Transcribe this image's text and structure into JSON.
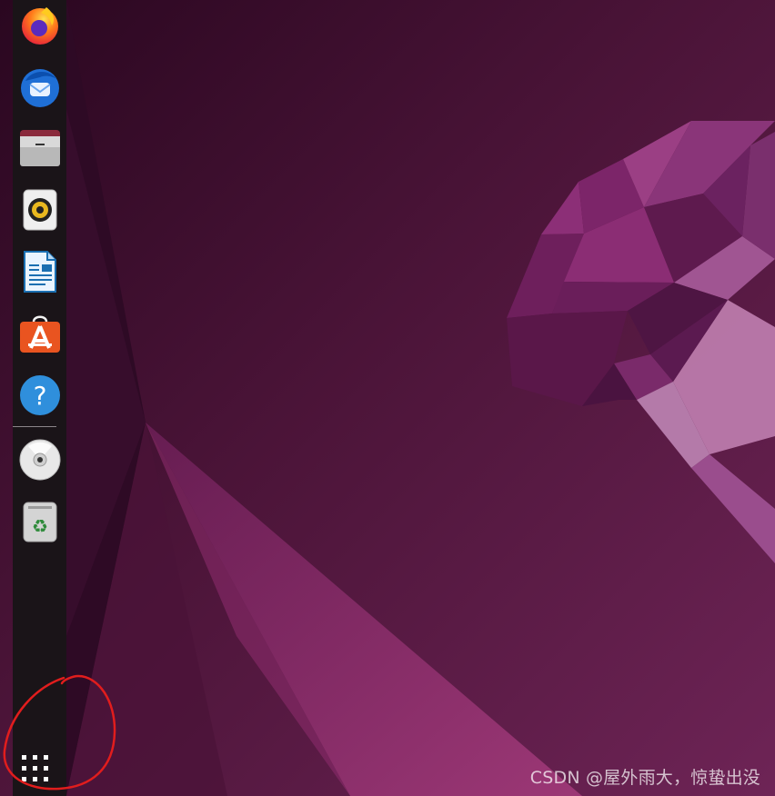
{
  "dock": {
    "apps": [
      {
        "name": "Firefox",
        "icon": "firefox-icon"
      },
      {
        "name": "Thunderbird",
        "icon": "thunderbird-icon"
      },
      {
        "name": "Files",
        "icon": "files-icon"
      },
      {
        "name": "Rhythmbox",
        "icon": "rhythmbox-icon"
      },
      {
        "name": "LibreOffice Writer",
        "icon": "libreoffice-writer-icon"
      },
      {
        "name": "Ubuntu Software",
        "icon": "ubuntu-software-icon"
      },
      {
        "name": "Help",
        "icon": "help-icon"
      },
      {
        "name": "Disc",
        "icon": "disc-icon"
      },
      {
        "name": "Trash",
        "icon": "trash-icon"
      }
    ],
    "show_applications_icon": "grid-icon"
  },
  "annotation": {
    "color": "#e11d1d",
    "shape": "hand-drawn circle around show applications button"
  },
  "watermark": {
    "text": "CSDN @屋外雨大，惊蛰出没"
  },
  "colors": {
    "wallpaper_dark": "#2b0a24",
    "wallpaper_mid": "#6b1f55",
    "accent_orange": "#e95420",
    "dock": "#1a1418"
  }
}
